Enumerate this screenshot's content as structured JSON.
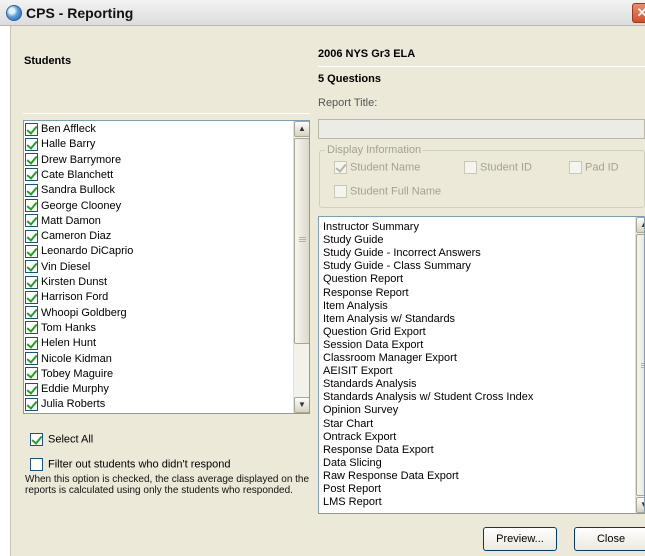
{
  "window": {
    "title": "CPS - Reporting",
    "close_glyph": "✕"
  },
  "students": {
    "header": "Students",
    "items": [
      {
        "name": "Ben Affleck",
        "checked": true
      },
      {
        "name": "Halle Barry",
        "checked": true
      },
      {
        "name": "Drew Barrymore",
        "checked": true
      },
      {
        "name": "Cate Blanchett",
        "checked": true
      },
      {
        "name": "Sandra Bullock",
        "checked": true
      },
      {
        "name": "George Clooney",
        "checked": true
      },
      {
        "name": "Matt Damon",
        "checked": true
      },
      {
        "name": "Cameron Diaz",
        "checked": true
      },
      {
        "name": "Leonardo DiCaprio",
        "checked": true
      },
      {
        "name": "Vin Diesel",
        "checked": true
      },
      {
        "name": "Kirsten Dunst",
        "checked": true
      },
      {
        "name": "Harrison Ford",
        "checked": true
      },
      {
        "name": "Whoopi Goldberg",
        "checked": true
      },
      {
        "name": "Tom Hanks",
        "checked": true
      },
      {
        "name": "Helen Hunt",
        "checked": true
      },
      {
        "name": "Nicole Kidman",
        "checked": true
      },
      {
        "name": "Tobey Maguire",
        "checked": true
      },
      {
        "name": "Eddie Murphy",
        "checked": true
      },
      {
        "name": "Julia Roberts",
        "checked": true
      }
    ],
    "select_all_label": "Select All",
    "select_all_checked": true,
    "filter_label": "Filter out students who didn't respond",
    "filter_checked": false,
    "filter_note": "When this option is checked, the class average displayed on the reports is calculated using only the students who responded."
  },
  "assessment": {
    "title": "2006 NYS Gr3 ELA",
    "questions": "5 Questions",
    "report_title_label": "Report Title:",
    "report_title_value": ""
  },
  "display_information": {
    "label": "Display Information",
    "options": [
      {
        "label": "Student Name",
        "checked": true
      },
      {
        "label": "Student ID",
        "checked": false
      },
      {
        "label": "Pad ID",
        "checked": false
      },
      {
        "label": "Student Full Name",
        "checked": false
      }
    ]
  },
  "reports": {
    "items": [
      "Instructor Summary",
      "Study Guide",
      "Study Guide - Incorrect Answers",
      "Study Guide - Class Summary",
      "Question Report",
      "Response Report",
      "Item Analysis",
      "Item Analysis w/ Standards",
      "Question Grid Export",
      "Session Data Export",
      "Classroom Manager Export",
      "AEISIT Export",
      "Standards Analysis",
      "Standards Analysis w/ Student Cross Index",
      "Opinion Survey",
      "Star Chart",
      "Ontrack Export",
      "Response Data Export",
      "Data Slicing",
      "Raw Response Data Export",
      "Post Report",
      "LMS Report"
    ]
  },
  "buttons": {
    "preview": "Preview...",
    "close": "Close"
  },
  "icons": {
    "scroll_up": "▲",
    "scroll_down": "▼"
  }
}
